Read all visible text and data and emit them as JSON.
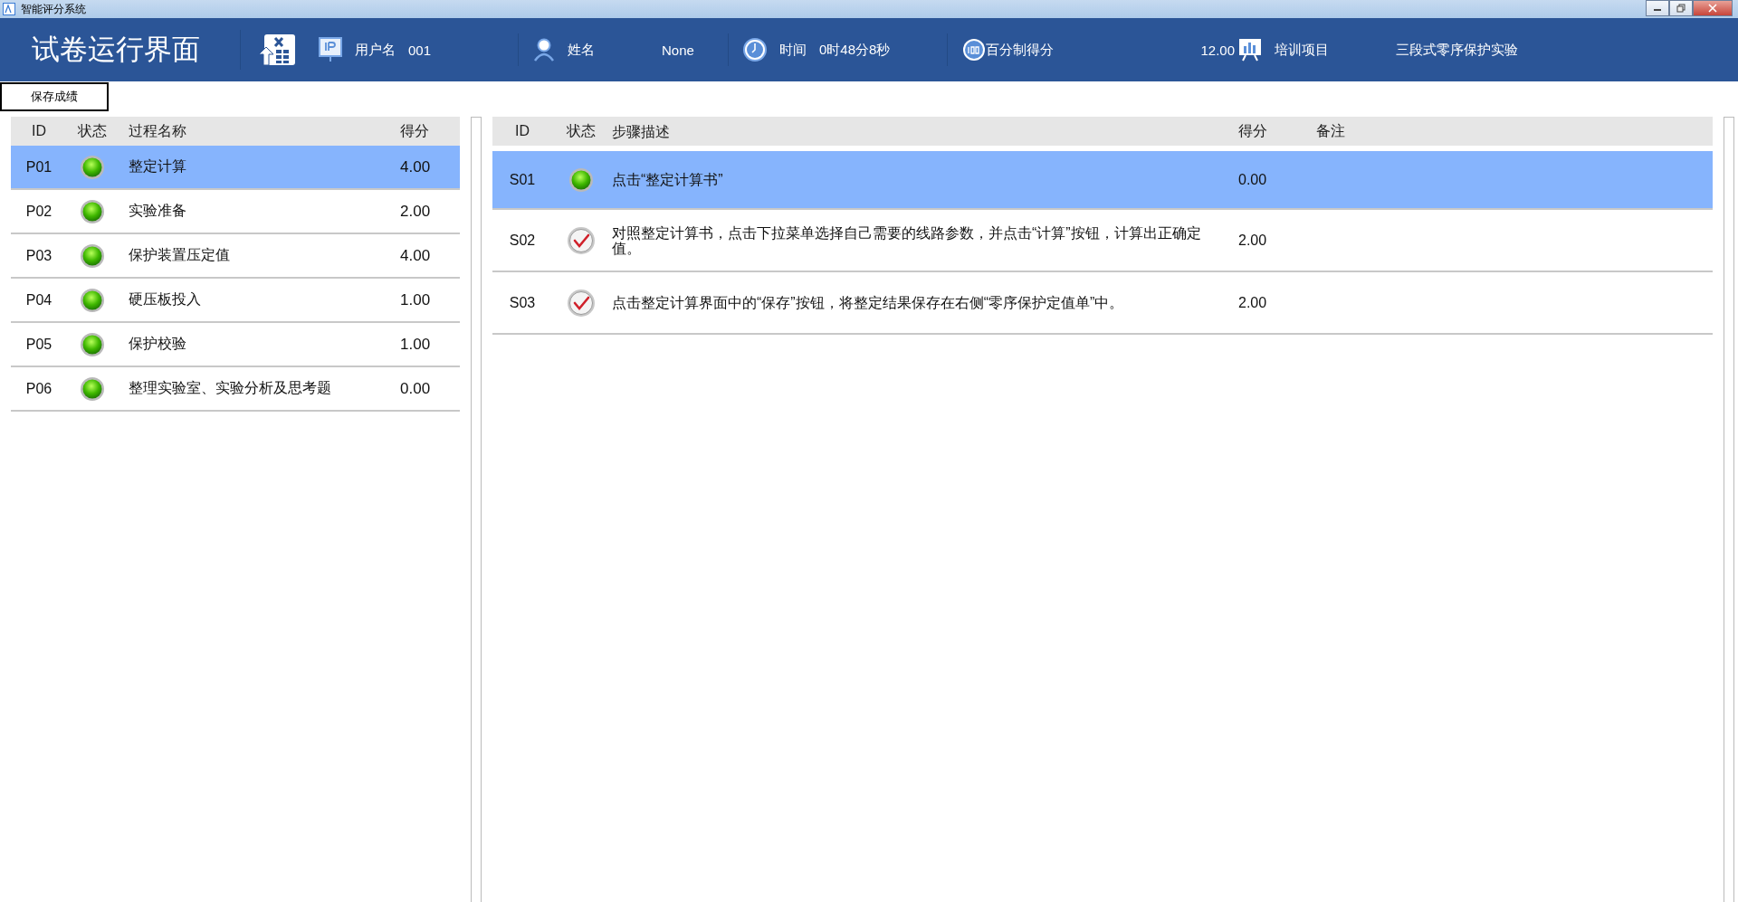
{
  "window": {
    "title": "智能评分系统"
  },
  "header": {
    "title": "试卷运行界面",
    "items": [
      {
        "kind": "user",
        "label": "用户名",
        "value": "001"
      },
      {
        "kind": "person",
        "label": "姓名",
        "value": "None"
      },
      {
        "kind": "clock",
        "label": "时间",
        "value": "0时48分8秒"
      },
      {
        "kind": "score",
        "label": "百分制得分",
        "value": "12.00"
      },
      {
        "kind": "project",
        "label": "培训项目",
        "value": "三段式零序保护实验"
      }
    ]
  },
  "save_button": "保存成绩",
  "process_table": {
    "columns": [
      "ID",
      "状态",
      "过程名称",
      "得分"
    ],
    "rows": [
      {
        "id": "P01",
        "kind": "dot",
        "name": "整定计算",
        "score": "4.00",
        "selected": true
      },
      {
        "id": "P02",
        "kind": "dot",
        "name": "实验准备",
        "score": "2.00",
        "selected": false
      },
      {
        "id": "P03",
        "kind": "dot",
        "name": "保护装置压定值",
        "score": "4.00",
        "selected": false
      },
      {
        "id": "P04",
        "kind": "dot",
        "name": "硬压板投入",
        "score": "1.00",
        "selected": false
      },
      {
        "id": "P05",
        "kind": "dot",
        "name": "保护校验",
        "score": "1.00",
        "selected": false
      },
      {
        "id": "P06",
        "kind": "dot",
        "name": "整理实验室、实验分析及思考题",
        "score": "0.00",
        "selected": false
      }
    ]
  },
  "step_table": {
    "columns": [
      "ID",
      "状态",
      "步骤描述",
      "得分",
      "备注"
    ],
    "rows": [
      {
        "id": "S01",
        "kind": "dot",
        "description": "点击“整定计算书”",
        "score": "0.00",
        "selected": true
      },
      {
        "id": "S02",
        "kind": "check",
        "description": "对照整定计算书，点击下拉菜单选择自己需要的线路参数，并点击“计算”按钮，计算出正确定值。",
        "score": "2.00",
        "selected": false
      },
      {
        "id": "S03",
        "kind": "check",
        "description": "点击整定计算界面中的“保存”按钮，将整定结果保存在右侧“零序保护定值单”中。",
        "score": "2.00",
        "selected": false
      }
    ]
  }
}
